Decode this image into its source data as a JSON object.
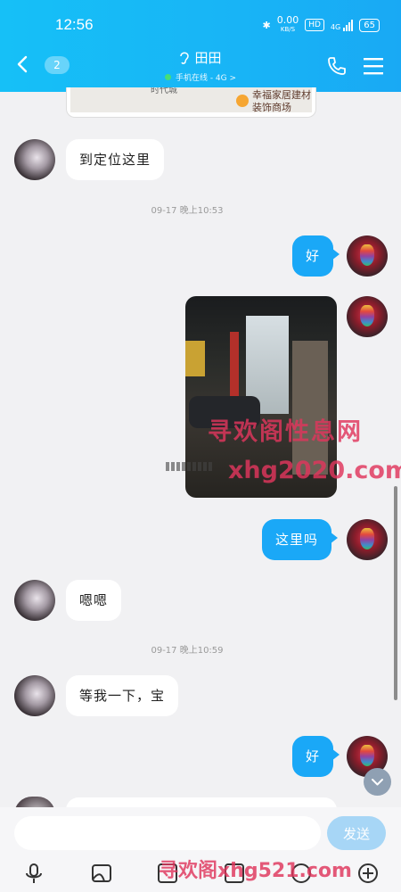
{
  "status_bar": {
    "time": "12:56",
    "net_speed": "0.00",
    "net_unit": "KB/S",
    "hd": "HD",
    "signal": "4G",
    "battery": "65"
  },
  "header": {
    "unread_count": "2",
    "contact_name": "田田",
    "contact_status": "手机在线 - 4G >",
    "accent": "#18b4f6"
  },
  "map_card": {
    "road_label": "时代城",
    "place_name_line1": "幸福家居建材",
    "place_name_line2": "装饰商场"
  },
  "messages": [
    {
      "side": "left",
      "text": "到定位这里"
    },
    {
      "side": "time",
      "text": "09-17 晚上10:53"
    },
    {
      "side": "right",
      "text": "好"
    },
    {
      "side": "right",
      "type": "image"
    },
    {
      "side": "right",
      "text": "这里吗"
    },
    {
      "side": "left",
      "text": "嗯嗯"
    },
    {
      "side": "time",
      "text": "09-17 晚上10:59"
    },
    {
      "side": "left",
      "text": "等我一下，宝"
    },
    {
      "side": "right",
      "text": "好"
    }
  ],
  "composer": {
    "input_value": "",
    "send_label": "发送"
  },
  "toolbar": {
    "icons": [
      "microphone-icon",
      "image-icon",
      "camera-icon",
      "file-icon",
      "emoji-icon",
      "plus-icon"
    ]
  },
  "watermarks": {
    "line1": "寻欢阁性息网",
    "line2": "xhg2020.com",
    "line3": "寻欢阁xhg521.com"
  }
}
